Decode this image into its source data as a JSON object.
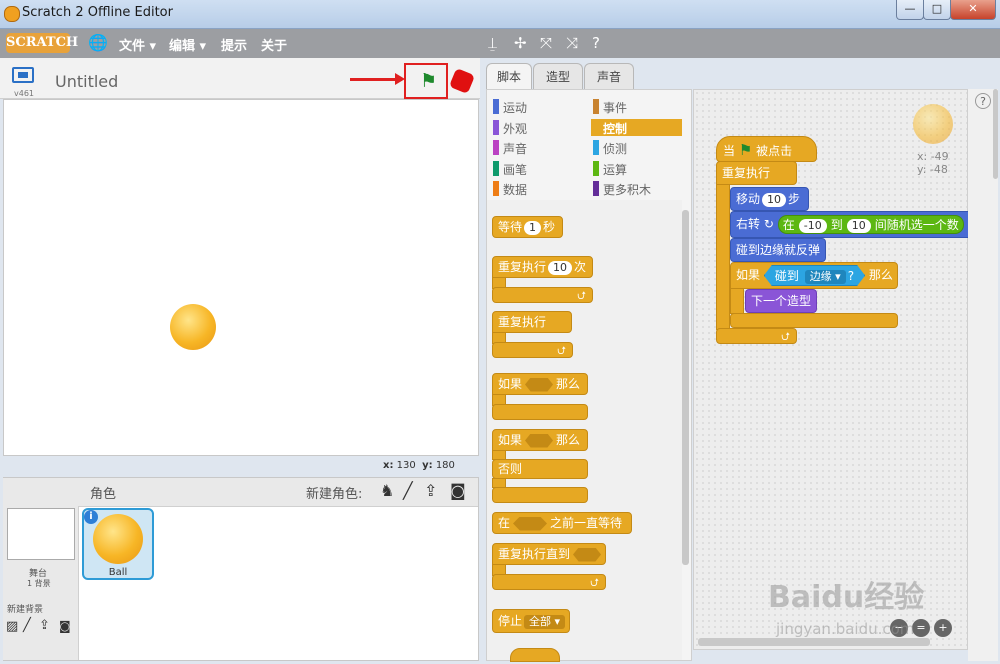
{
  "window": {
    "title": "Scratch 2 Offline Editor",
    "min": "—",
    "max": "□",
    "close": "✕"
  },
  "menubar": {
    "logo": "SCRATCH",
    "items": [
      "文件 ▾",
      "编辑 ▾",
      "提示",
      "关于"
    ]
  },
  "stage": {
    "version": "v461",
    "project_name": "Untitled",
    "coords": {
      "x_label": "x:",
      "x": "130",
      "y_label": "y:",
      "y": "180"
    }
  },
  "sprites": {
    "header": "角色",
    "new_sprite_label": "新建角色:",
    "stage_label": "舞台",
    "stage_backdrops": "1 背景",
    "new_backdrop": "新建背景",
    "sprite_names": [
      "Ball"
    ]
  },
  "tabs": [
    "脚本",
    "造型",
    "声音"
  ],
  "categories": {
    "left": [
      {
        "label": "运动",
        "color": "#4a6cd4"
      },
      {
        "label": "外观",
        "color": "#8a55d7"
      },
      {
        "label": "声音",
        "color": "#bb42c3"
      },
      {
        "label": "画笔",
        "color": "#0e9a6c"
      },
      {
        "label": "数据",
        "color": "#ee7d16"
      }
    ],
    "right": [
      {
        "label": "事件",
        "color": "#c88330"
      },
      {
        "label": "控制",
        "color": "#e6a823"
      },
      {
        "label": "侦测",
        "color": "#2ca5e2"
      },
      {
        "label": "运算",
        "color": "#5cb712"
      },
      {
        "label": "更多积木",
        "color": "#632d99"
      }
    ],
    "selected": "控制"
  },
  "palette": {
    "wait": {
      "pre": "等待",
      "val": "1",
      "post": "秒"
    },
    "repeat": {
      "pre": "重复执行",
      "val": "10",
      "post": "次"
    },
    "forever": "重复执行",
    "if_then": {
      "pre": "如果",
      "post": "那么"
    },
    "if_else": {
      "pre": "如果",
      "post": "那么",
      "else": "否则"
    },
    "wait_until": {
      "pre": "在",
      "post": "之前一直等待"
    },
    "repeat_until": "重复执行直到",
    "stop": {
      "pre": "停止",
      "val": "全部 ▾"
    }
  },
  "script": {
    "hat": {
      "pre": "当",
      "post": "被点击"
    },
    "forever": "重复执行",
    "move": {
      "pre": "移动",
      "val": "10",
      "post": "步"
    },
    "turn": {
      "pre": "右转",
      "mid": "在",
      "a": "-10",
      "to": "到",
      "b": "10",
      "post": "间随机选一个数"
    },
    "bounce": "碰到边缘就反弹",
    "if": {
      "pre": "如果",
      "touch": "碰到",
      "edge": "边缘 ▾",
      "q": "?",
      "post": "那么"
    },
    "next_costume": "下一个造型",
    "sprite_info": {
      "x": "x: -49",
      "y": "y: -48"
    }
  },
  "watermark": {
    "brand": "Baidu经验",
    "url": "jingyan.baidu.com"
  }
}
